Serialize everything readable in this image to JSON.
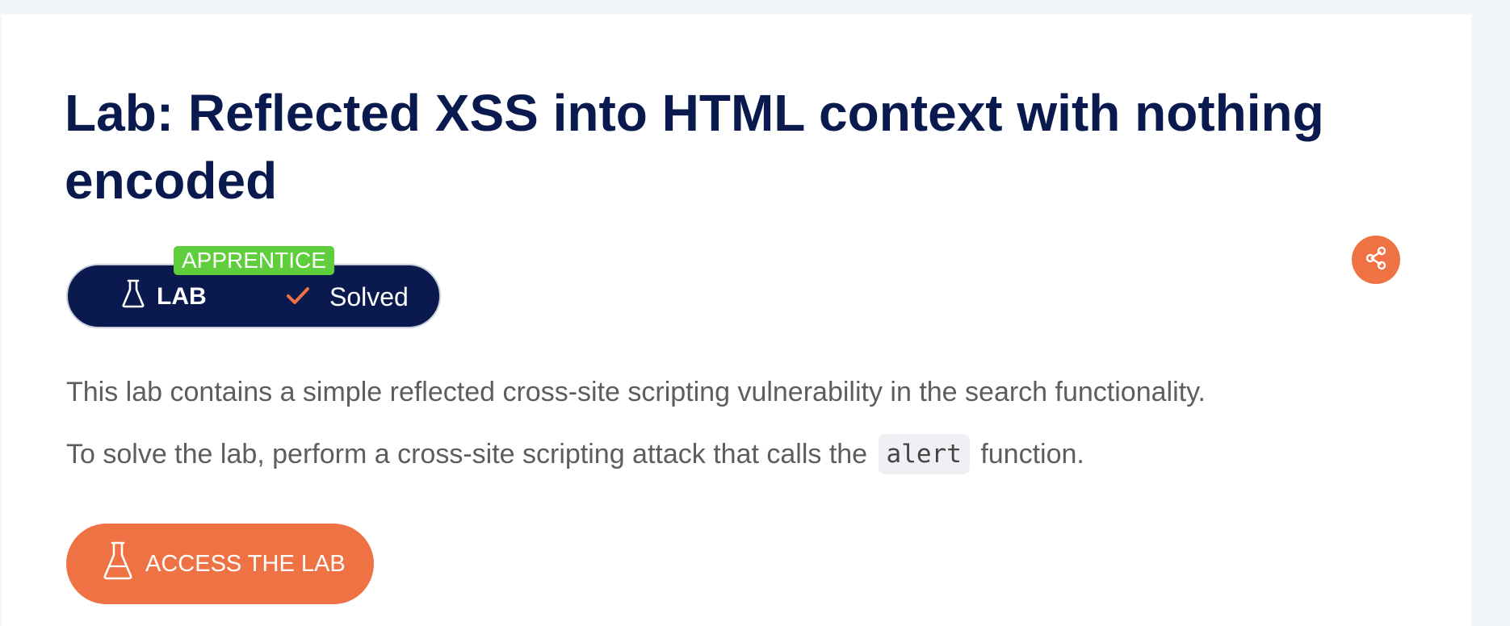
{
  "lab": {
    "title": "Lab: Reflected XSS into HTML context with nothing encoded",
    "level": "APPRENTICE",
    "type_label": "LAB",
    "status_label": "Solved",
    "description_1": "This lab contains a simple reflected cross-site scripting vulnerability in the search functionality.",
    "description_2_before": "To solve the lab, perform a cross-site scripting attack that calls the",
    "description_2_code": "alert",
    "description_2_after": "function.",
    "access_button_label": "ACCESS THE LAB"
  },
  "icons": {
    "lab": "flask-icon",
    "solved": "checkmark-icon",
    "share": "share-icon"
  },
  "colors": {
    "navy": "#0a1a4f",
    "accent": "#ee7244",
    "level_green": "#5fce3c",
    "text_gray": "#5d5d5d"
  }
}
